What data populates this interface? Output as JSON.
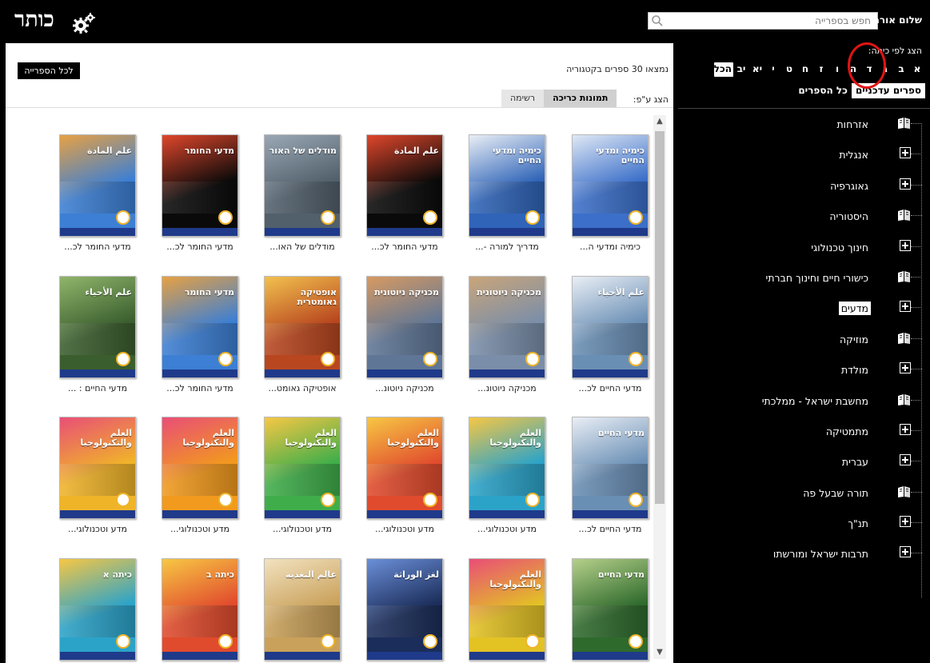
{
  "header": {
    "greeting": "שלום אורח",
    "search_placeholder": "חפש בספרייה",
    "logo_text": "כותר"
  },
  "sidebar": {
    "grade_label": "הצג לפי כיתה:",
    "grades": [
      "א",
      "ב",
      "ג",
      "ד",
      "ה",
      "ו",
      "ז",
      "ח",
      "ט",
      "י",
      "יא",
      "יב",
      "הכל"
    ],
    "filters": [
      {
        "label": "ספרים עדכניים",
        "active": true
      },
      {
        "label": "כל הספרים",
        "active": false
      }
    ],
    "categories": [
      {
        "label": "אזרחות",
        "icon": "book-icon",
        "selected": false
      },
      {
        "label": "אנגלית",
        "icon": "plus-icon",
        "selected": false
      },
      {
        "label": "גאוגרפיה",
        "icon": "plus-icon",
        "selected": false
      },
      {
        "label": "היסטוריה",
        "icon": "book-icon",
        "selected": false
      },
      {
        "label": "חינוך טכנולוגי",
        "icon": "plus-icon",
        "selected": false
      },
      {
        "label": "כישורי חיים וחינוך חברתי",
        "icon": "book-icon",
        "selected": false
      },
      {
        "label": "מדעים",
        "icon": "plus-icon",
        "selected": true
      },
      {
        "label": "מוזיקה",
        "icon": "book-icon",
        "selected": false
      },
      {
        "label": "מולדת",
        "icon": "plus-icon",
        "selected": false
      },
      {
        "label": "מחשבת ישראל - ממלכתי",
        "icon": "book-icon",
        "selected": false
      },
      {
        "label": "מתמטיקה",
        "icon": "plus-icon",
        "selected": false
      },
      {
        "label": "עברית",
        "icon": "plus-icon",
        "selected": false
      },
      {
        "label": "תורה שבעל פה",
        "icon": "book-icon",
        "selected": false
      },
      {
        "label": "תנ\"ך",
        "icon": "plus-icon",
        "selected": false
      },
      {
        "label": "תרבות ישראל ומורשתו",
        "icon": "plus-icon",
        "selected": false
      }
    ]
  },
  "main": {
    "results_count": "נמצאו 30 ספרים בקטגוריה",
    "all_library_button": "לכל הספרייה",
    "view_label": "הצג ע\"פ:",
    "view_tabs": [
      {
        "label": "תמונות כריכה",
        "active": true
      },
      {
        "label": "רשימה",
        "active": false
      }
    ],
    "books": [
      {
        "title": "כימיה ומדעי ה...",
        "cover_title": "כימיה ומדעי החיים",
        "bg": "#3b6fc9",
        "accent": "#dfe8f5"
      },
      {
        "title": "מדריך למורה -...",
        "cover_title": "כימיה ומדעי החיים",
        "bg": "#2f64b8",
        "accent": "#e9eef5"
      },
      {
        "title": "מדעי החומר לכ...",
        "cover_title": "علم المادة",
        "bg": "#0a0a0a",
        "accent": "#e0462b"
      },
      {
        "title": "מודלים של האו...",
        "cover_title": "מודלים של האור",
        "bg": "#52606c",
        "accent": "#9aa7b4"
      },
      {
        "title": "מדעי החומר לכ...",
        "cover_title": "מדעי החומר",
        "bg": "#0a0a0a",
        "accent": "#e0462b"
      },
      {
        "title": "מדעי החומר לכ...",
        "cover_title": "علم المادة",
        "bg": "#3c7fd4",
        "accent": "#e7a143"
      },
      {
        "title": "מדעי החיים לכ...",
        "cover_title": "علم الأحياء",
        "bg": "#6a8fb5",
        "accent": "#e9eef5"
      },
      {
        "title": "מכניקה ניוטונ...",
        "cover_title": "מכניקה ניוטונית",
        "bg": "#7a8ea9",
        "accent": "#c9a57a"
      },
      {
        "title": "מכניקה ניוטונ...",
        "cover_title": "מכניקה ניוטונית",
        "bg": "#5f7696",
        "accent": "#d79a62"
      },
      {
        "title": "אופטיקה גאומט...",
        "cover_title": "אופטיקה גאומטרית",
        "bg": "#b8461f",
        "accent": "#f2c14e"
      },
      {
        "title": "מדעי החומר לכ...",
        "cover_title": "מדעי החומר",
        "bg": "#3c7fd4",
        "accent": "#e7a143"
      },
      {
        "title": "מדעי החיים : ...",
        "cover_title": "علم الأحياء",
        "bg": "#3b5e2e",
        "accent": "#8fb56b"
      },
      {
        "title": "מדעי החיים לכ...",
        "cover_title": "מדעי החיים",
        "bg": "#6a8fb5",
        "accent": "#e9eef5"
      },
      {
        "title": "מדע וטכנולוגי...",
        "cover_title": "العلم والتكنولوجيا",
        "bg": "#2ba3c9",
        "accent": "#f7c744"
      },
      {
        "title": "מדע וטכנולוגי...",
        "cover_title": "العلم والتكنولوجيا",
        "bg": "#e14b2d",
        "accent": "#f7c744"
      },
      {
        "title": "מדע וטכנולוגי...",
        "cover_title": "العلم والتكنولوجيا",
        "bg": "#3fae4a",
        "accent": "#f7c744"
      },
      {
        "title": "מדע וטכנולוגי...",
        "cover_title": "العلم والتكنولوجيا",
        "bg": "#f29a1d",
        "accent": "#e94e77"
      },
      {
        "title": "מדע וטכנולוגי...",
        "cover_title": "العلم والتكنولوجيا",
        "bg": "#f0b429",
        "accent": "#e94e77"
      },
      {
        "title": "",
        "cover_title": "מדעי החיים",
        "bg": "#2f6a2d",
        "accent": "#b5d08a"
      },
      {
        "title": "",
        "cover_title": "العلم والتكنولوجيا",
        "bg": "#e3c224",
        "accent": "#e94e77"
      },
      {
        "title": "",
        "cover_title": "لغز الوراثة",
        "bg": "#1b2d5a",
        "accent": "#6b8fd8"
      },
      {
        "title": "",
        "cover_title": "عالم التغذية",
        "bg": "#c9a15a",
        "accent": "#f2e2c0"
      },
      {
        "title": "",
        "cover_title": "כיתה ב",
        "bg": "#e14b2d",
        "accent": "#f7c744"
      },
      {
        "title": "",
        "cover_title": "כיתה א",
        "bg": "#2ba3c9",
        "accent": "#f7c744"
      }
    ]
  },
  "colors": {
    "sidebar_bg": "#000000",
    "annotation_circle": "#e21414",
    "active_tab": "#d0d0d0"
  }
}
